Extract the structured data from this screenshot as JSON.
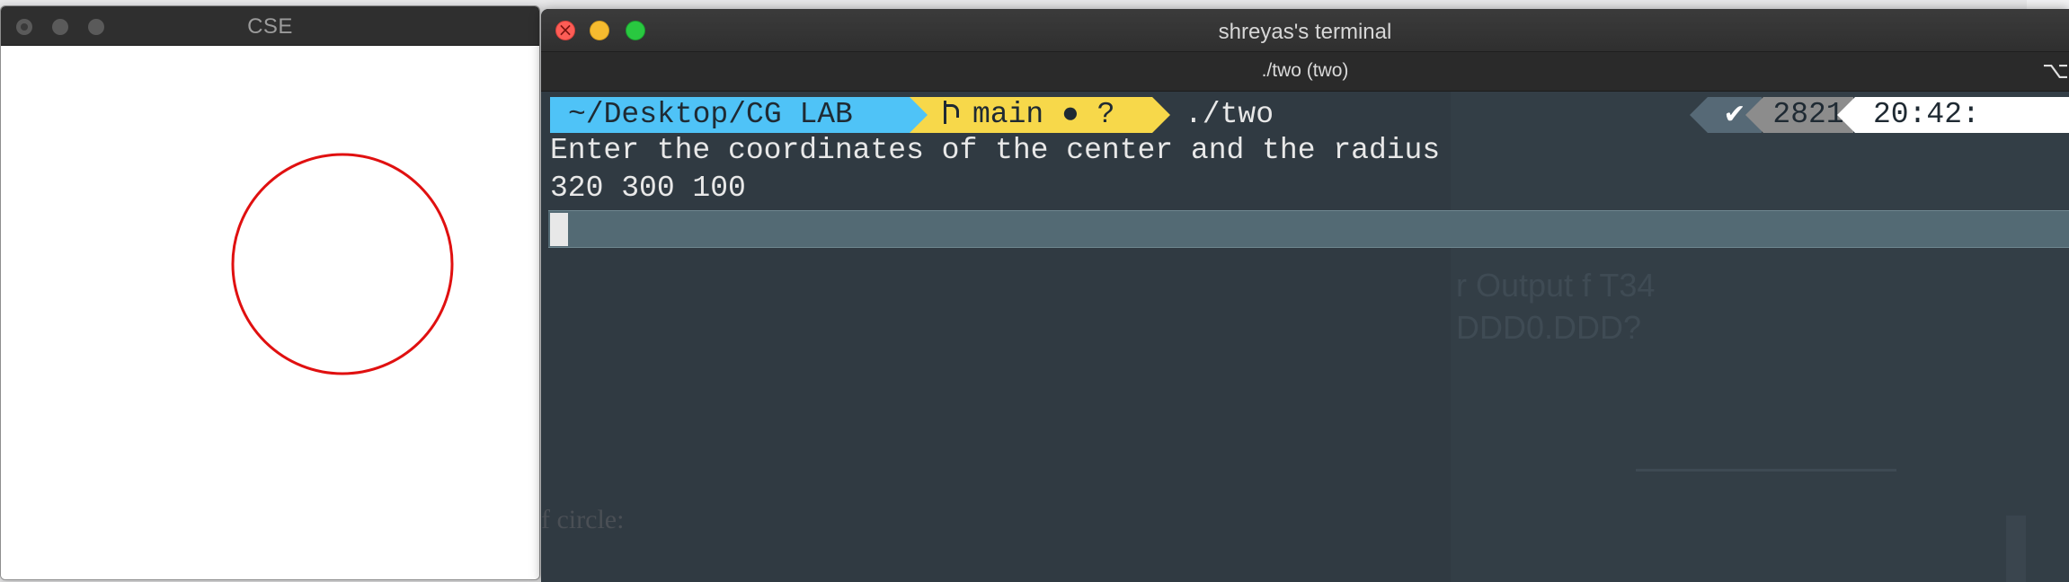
{
  "cse_window": {
    "title": "CSE",
    "circle": {
      "color": "#e01010"
    }
  },
  "terminal": {
    "window_title": "shreyas's terminal",
    "tab_title": "./two (two)",
    "shortcut_glyph": "⌥",
    "prompt": {
      "path": "~/Desktop/CG LAB",
      "branch": "main",
      "git_status": "● ?",
      "command": "./two",
      "status_icon": "✔",
      "history_number": "2821",
      "time": "20:42:"
    },
    "output": [
      "Enter the coordinates of the center and the radius",
      "320 300 100"
    ]
  },
  "background": {
    "ghost_text_1": "r Output f    T34",
    "ghost_text_2": "DDD0.DDD?",
    "ghost_text_3": "f circle:"
  },
  "colors": {
    "path_segment": "#4fc3f7",
    "git_segment": "#f7d84a",
    "status_segment": "#566976",
    "count_segment": "#8c8c8c",
    "terminal_bg": "#303a42"
  }
}
